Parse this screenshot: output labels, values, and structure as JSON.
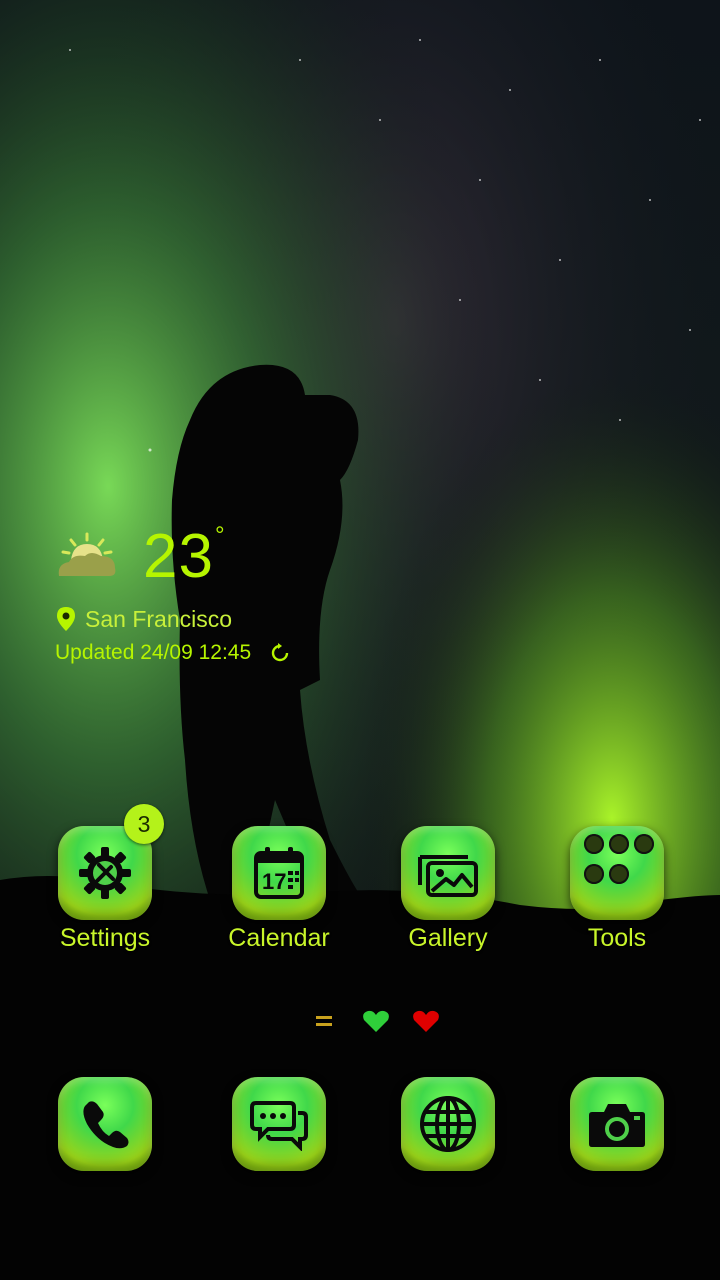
{
  "weather": {
    "temperature": "23",
    "unit": "°",
    "location": "San Francisco",
    "updated": "Updated 24/09 12:45",
    "icon": "sun-cloud-icon"
  },
  "apps": [
    {
      "label": "Settings",
      "icon": "gear-tools-icon",
      "badge": "3"
    },
    {
      "label": "Calendar",
      "icon": "calendar-icon",
      "date": "17"
    },
    {
      "label": "Gallery",
      "icon": "gallery-icon"
    },
    {
      "label": "Tools",
      "icon": "folder-icon"
    }
  ],
  "dock": [
    {
      "icon": "phone-icon"
    },
    {
      "icon": "messages-icon"
    },
    {
      "icon": "browser-globe-icon"
    },
    {
      "icon": "camera-icon"
    }
  ],
  "page_indicators": [
    "menu-lines-icon",
    "green-heart-icon",
    "red-heart-icon"
  ],
  "colors": {
    "accent": "#b6f500",
    "icon_green": "#4fe04a",
    "heart_red": "#e00000"
  }
}
